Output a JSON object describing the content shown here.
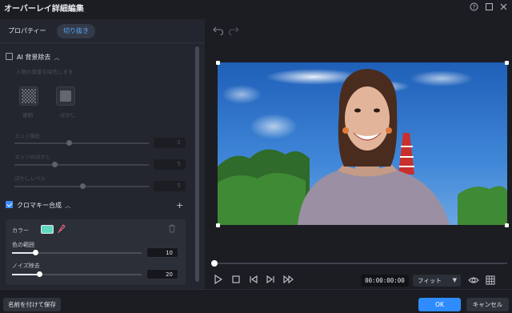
{
  "window": {
    "title": "オーバーレイ詳細編集"
  },
  "tabs": [
    {
      "label": "プロパティー",
      "active": false
    },
    {
      "label": "切り抜き",
      "active": true
    }
  ],
  "ai_bg_removal": {
    "label": "AI 背景除去",
    "hint": "人物の背景を除去します",
    "options": [
      {
        "label": "透明"
      },
      {
        "label": "ぼかし"
      }
    ],
    "sliders": [
      {
        "label": "エッジ強化",
        "value": "-2"
      },
      {
        "label": "エッジのぼかし",
        "value": "5"
      },
      {
        "label": "ぼかしレベル",
        "value": "5"
      }
    ]
  },
  "chroma_key": {
    "label": "クロマキー合成",
    "color_label": "カラー",
    "swatch_color": "#5fd9c0",
    "sliders": [
      {
        "label": "色の範囲",
        "value": "10"
      },
      {
        "label": "ノイズ除去",
        "value": "20"
      }
    ]
  },
  "player": {
    "timecode": "00:00:00:00",
    "fit": "フィット"
  },
  "buttons": {
    "save_as": "名前を付けて保存",
    "ok": "OK",
    "cancel": "キャンセル"
  },
  "colors": {
    "accent": "#3a8dff",
    "ok_button": "#2f8cff"
  }
}
